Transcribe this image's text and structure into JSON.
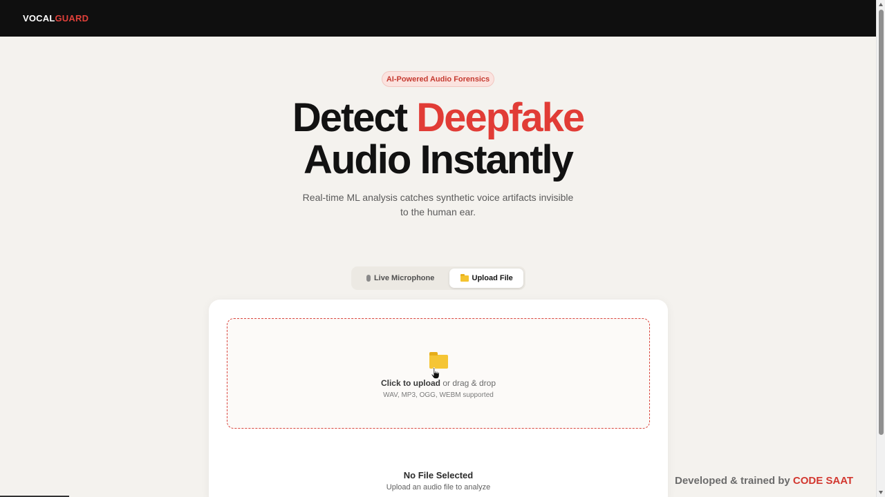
{
  "nav": {
    "logo_part1": "VOCAL",
    "logo_part2": "GUARD"
  },
  "hero": {
    "badge": "AI-Powered Audio Forensics",
    "headline_word1": "Detect",
    "headline_accent": "Deepfake",
    "headline_line2": "Audio Instantly",
    "subtitle_line1": "Real-time ML analysis catches synthetic voice artifacts invisible",
    "subtitle_line2": "to the human ear."
  },
  "tabs": [
    {
      "label": "Live Microphone",
      "icon": "microphone-icon",
      "active": false
    },
    {
      "label": "Upload File",
      "icon": "folder-icon",
      "active": true
    }
  ],
  "upload": {
    "cta_bold": "Click to upload",
    "cta_rest": " or drag & drop",
    "formats": "WAV, MP3, OGG, WEBM supported"
  },
  "status": {
    "title": "No File Selected",
    "subtitle": "Upload an audio file to analyze"
  },
  "footer": {
    "credit_prefix": "Developed & trained by ",
    "credit_brand": "CODE SAAT"
  },
  "colors": {
    "accent": "#e13c36",
    "nav_bg": "#0f0f0f",
    "page_bg": "#f4f2ee",
    "folder": "#f5c535"
  }
}
